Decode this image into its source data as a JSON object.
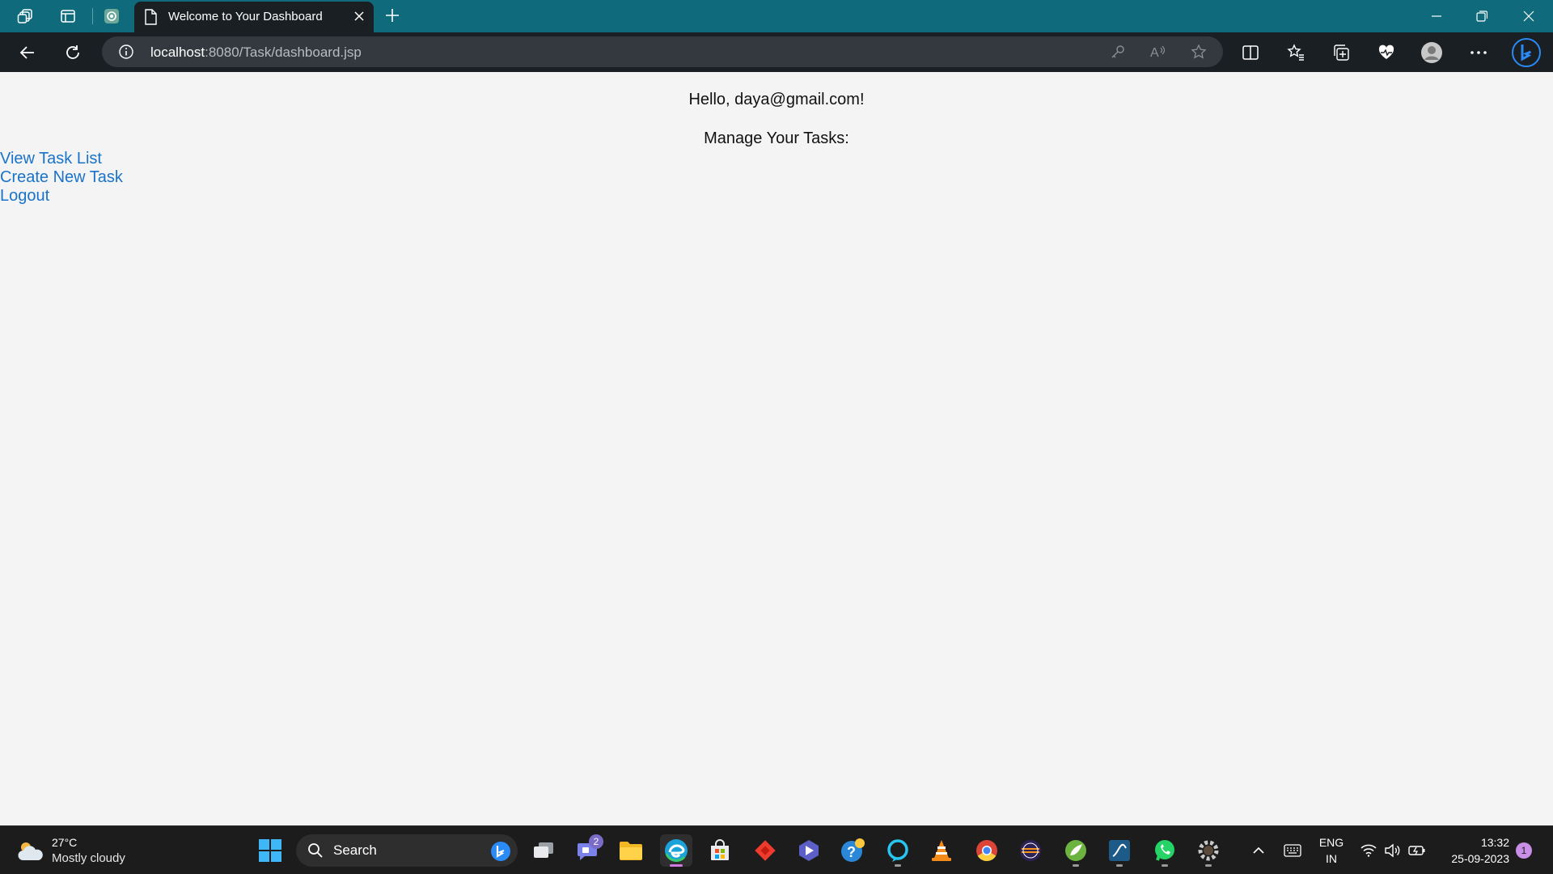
{
  "browser": {
    "tab_title": "Welcome to Your Dashboard",
    "url_host": "localhost",
    "url_path": ":8080/Task/dashboard.jsp"
  },
  "page": {
    "greeting": "Hello, daya@gmail.com!",
    "manage_heading": "Manage Your Tasks:",
    "links": {
      "view_tasks": "View Task List",
      "create_task": "Create New Task",
      "logout": "Logout"
    }
  },
  "taskbar": {
    "weather_temp": "27°C",
    "weather_condition": "Mostly cloudy",
    "search_label": "Search",
    "teams_badge": "2",
    "lang_line1": "ENG",
    "lang_line2": "IN",
    "time": "13:32",
    "date": "25-09-2023",
    "notification_count": "1"
  },
  "colors": {
    "tabbar_bg": "#0f6b7c",
    "toolbar_bg": "#1a1f23",
    "page_bg": "#f4f4f4",
    "link": "#1a73c9",
    "taskbar_bg": "#1c1c1c"
  }
}
